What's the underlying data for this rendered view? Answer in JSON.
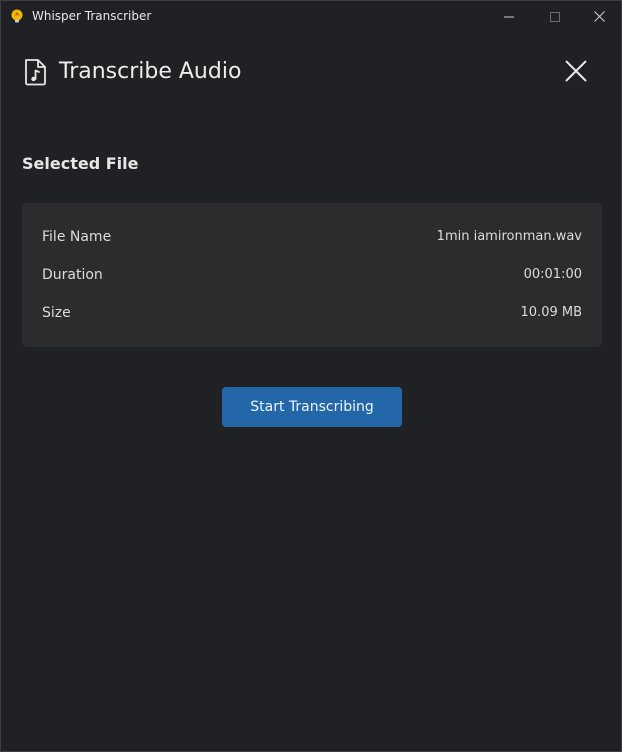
{
  "window": {
    "app_title": "Whisper Transcriber"
  },
  "header": {
    "title": "Transcribe Audio"
  },
  "section": {
    "title": "Selected File"
  },
  "file_info": [
    {
      "label": "File Name",
      "value": "1min iamironman.wav"
    },
    {
      "label": "Duration",
      "value": "00:01:00"
    },
    {
      "label": "Size",
      "value": "10.09 MB"
    }
  ],
  "actions": {
    "start_label": "Start Transcribing"
  },
  "colors": {
    "background": "#202124",
    "card": "#2c2c2e",
    "accent": "#2367a8"
  },
  "icons": {
    "app": "lightbulb-icon",
    "header": "audio-file-icon",
    "close": "close-icon"
  }
}
